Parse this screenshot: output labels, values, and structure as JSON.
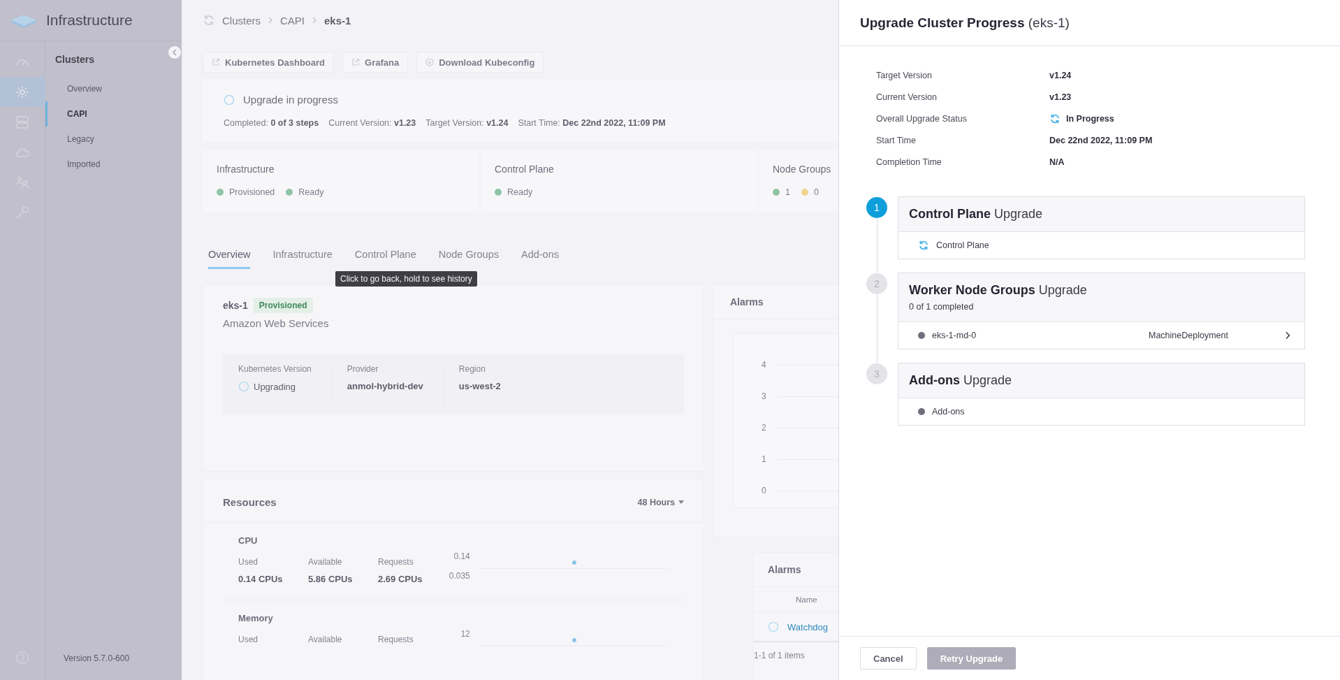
{
  "sidebar": {
    "app_title": "Infrastructure",
    "rail": [
      {
        "selected": false
      },
      {
        "selected": true
      },
      {
        "selected": false
      },
      {
        "selected": false
      },
      {
        "selected": false
      },
      {
        "selected": false
      }
    ],
    "nav_heading": "Clusters",
    "nav": [
      {
        "label": "Overview",
        "selected": false
      },
      {
        "label": "CAPI",
        "selected": true
      },
      {
        "label": "Legacy",
        "selected": false
      },
      {
        "label": "Imported",
        "selected": false
      }
    ],
    "version": "Version 5.7.0-600"
  },
  "breadcrumb": [
    "Clusters",
    "CAPI",
    "eks-1"
  ],
  "actions": [
    {
      "label": "Kubernetes Dashboard",
      "kind": "external"
    },
    {
      "label": "Grafana",
      "kind": "external"
    },
    {
      "label": "Download Kubeconfig",
      "kind": "download"
    }
  ],
  "upgrade_banner": {
    "title": "Upgrade in progress",
    "stats": [
      "Completed: **0 of 3 steps**",
      "Current Version: **v1.23**",
      "Target Version: **v1.24**",
      "Start Time: **Dec 22nd 2022, 11:09 PM**"
    ]
  },
  "status_cards": [
    {
      "title": "Infrastructure",
      "statuses": [
        {
          "label": "Provisioned",
          "color": "#8fc4a6"
        },
        {
          "label": "Ready",
          "color": "#8fc4a6"
        }
      ]
    },
    {
      "title": "Control Plane",
      "statuses": [
        {
          "label": "Ready",
          "color": "#8fc4a6"
        }
      ]
    },
    {
      "title": "Node Groups",
      "statuses": [
        {
          "label": "1",
          "color": "#8fc4a6"
        },
        {
          "label": "0",
          "color": "#f0d48f"
        }
      ]
    }
  ],
  "tabs": [
    {
      "label": "Overview",
      "selected": true
    },
    {
      "label": "Infrastructure",
      "selected": false
    },
    {
      "label": "Control Plane",
      "selected": false
    },
    {
      "label": "Node Groups",
      "selected": false
    },
    {
      "label": "Add-ons",
      "selected": false
    }
  ],
  "tooltip": "Click to go back, hold to see history",
  "overview": {
    "name": "eks-1",
    "badge": "Provisioned",
    "provider_name": "Amazon Web Services",
    "fields": [
      {
        "label": "Kubernetes Version",
        "value": "Upgrading",
        "kind": "spinner"
      },
      {
        "label": "Provider",
        "value": "anmol-hybrid-dev",
        "kind": "text"
      },
      {
        "label": "Region",
        "value": "us-west-2",
        "kind": "text"
      }
    ]
  },
  "alarms_chart": {
    "title": "Alarms",
    "axis_labels": [
      "4",
      "3",
      "2",
      "1",
      "0"
    ]
  },
  "resources": {
    "title": "Resources",
    "range": "48 Hours",
    "groups": [
      {
        "title": "CPU",
        "metrics": [
          {
            "label": "Used",
            "value": "0.14 CPUs"
          },
          {
            "label": "Available",
            "value": "5.86 CPUs"
          },
          {
            "label": "Requests",
            "value": "2.69 CPUs"
          }
        ],
        "axis_labels": [
          "0.14",
          "0.035"
        ]
      },
      {
        "title": "Memory",
        "metrics": [
          {
            "label": "Used"
          },
          {
            "label": "Available"
          },
          {
            "label": "Requests"
          }
        ],
        "axis_labels": [
          "12"
        ]
      }
    ]
  },
  "alarms_table": {
    "title": "Alarms",
    "columns": [
      "Name"
    ],
    "rows": [
      {
        "name": "Watchdog"
      }
    ],
    "footer": "1-1 of 1 items"
  },
  "drawer": {
    "title": "**Upgrade Cluster Progress** (eks-1)",
    "details": [
      {
        "label": "Target Version",
        "value": "v1.24",
        "kind": "text"
      },
      {
        "label": "Current Version",
        "value": "v1.23",
        "kind": "text"
      },
      {
        "label": "Overall Upgrade Status",
        "value": "In Progress",
        "kind": "in_progress"
      },
      {
        "label": "Start Time",
        "value": "Dec 22nd 2022, 11:09 PM",
        "kind": "text"
      },
      {
        "label": "Completion Time",
        "value": "N/A",
        "kind": "text"
      }
    ],
    "steps": [
      {
        "number": "1",
        "title": "**Control Plane** Upgrade",
        "active": true,
        "items": [
          {
            "label": "Control Plane",
            "kind": "in_progress"
          }
        ]
      },
      {
        "number": "2",
        "title": "**Worker Node Groups** Upgrade",
        "active": false,
        "summary": "0 of 1 completed",
        "items": [
          {
            "label": "eks-1-md-0",
            "type": "MachineDeployment",
            "kind": "pending",
            "expandable": true
          }
        ]
      },
      {
        "number": "3",
        "title": "**Add-ons** Upgrade",
        "active": false,
        "items": [
          {
            "label": "Add-ons",
            "kind": "pending"
          }
        ]
      }
    ],
    "buttons": [
      {
        "label": "Cancel",
        "disabled": false
      },
      {
        "label": "Retry Upgrade",
        "disabled": true
      }
    ]
  }
}
